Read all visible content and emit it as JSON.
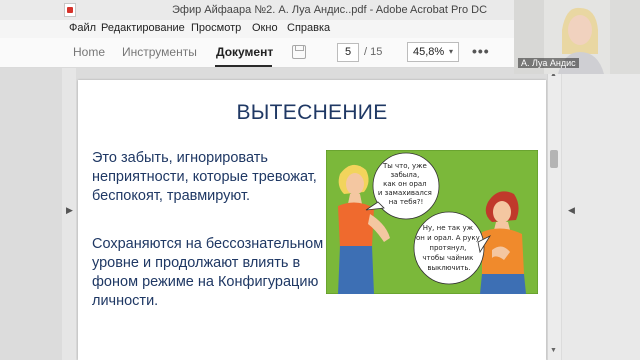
{
  "window": {
    "title": "Эфир Айфаара №2. А. Луа Андис..pdf - Adobe Acrobat Pro DC"
  },
  "menu": [
    "Файл",
    "Редактирование",
    "Просмотр",
    "Окно",
    "Справка"
  ],
  "tabs": [
    {
      "label": "Home",
      "active": false
    },
    {
      "label": "Инструменты",
      "active": false
    },
    {
      "label": "Документ",
      "active": true
    }
  ],
  "toolbar": {
    "page_current": "5",
    "page_total": "/ 15",
    "zoom": "45,8%",
    "zoom_caret": "▾",
    "more": "•••"
  },
  "slide": {
    "title": "ВЫТЕСНЕНИЕ",
    "paragraph1": "Это забыть, игнорировать неприятности, которые тревожат, беспокоят, травмируют.",
    "paragraph2": "Сохраняются на бессознательном уровне и продолжают влиять в фоном режиме на Конфигурацию личности.",
    "bubble_left": [
      "Ты что, уже",
      "забыла,",
      "как он орал",
      "и замахивался",
      "на тебя?!"
    ],
    "bubble_right": [
      "Ну, не так уж",
      "он и орал. А руку",
      "протянул,",
      "чтобы чайник",
      "выключить."
    ]
  },
  "webcam": {
    "name": "А. Луа Андис"
  },
  "colors": {
    "title_blue": "#1f3864",
    "illustration_green": "#7bb83a"
  }
}
